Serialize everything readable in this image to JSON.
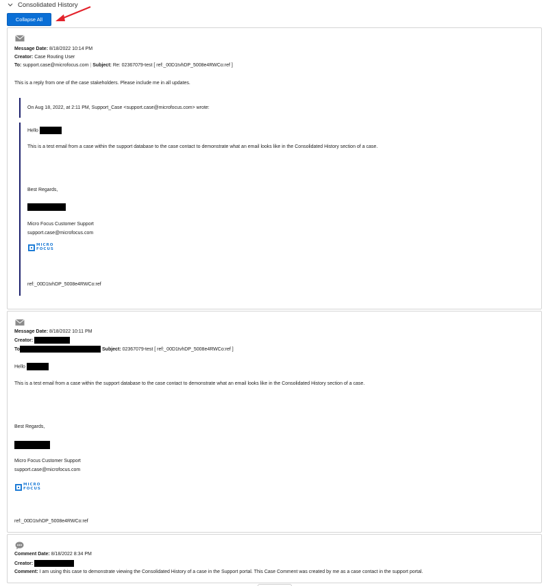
{
  "section": {
    "title": "Consolidated History"
  },
  "toolbar": {
    "collapse_label": "Collapse All"
  },
  "labels": {
    "message_date": "Message Date:",
    "creator": "Creator:",
    "to": "To:",
    "to_redacted": "To",
    "subject": "Subject:",
    "comment_date": "Comment Date:",
    "comment": "Comment:"
  },
  "email1": {
    "date": "8/18/2022 10:14 PM",
    "creator": "Case Routing User",
    "to": "support.case@microfocus.com",
    "subject": "Re: 02367079-test [ ref:_00D1tvhDP_5008e4RWCo:ref ]",
    "body": "This is a reply from one of the case stakeholders. Please include me in all updates.",
    "quote_header": "On Aug 18, 2022, at 2:11 PM, Support_Case <support.case@microfocus.com> wrote:",
    "greeting": "Hello",
    "quoted_body": "This is a test email from a case within the support database to the case contact to demonstrate what an email looks like in the Consolidated History section of a case.",
    "sign_off": "Best Regards,",
    "org": "Micro Focus Customer Support",
    "email": "support.case@microfocus.com",
    "logo_top": "MICRO",
    "logo_bottom": "FOCUS",
    "ref": "ref:_00D1tvhDP_5008e4RWCo:ref"
  },
  "email2": {
    "date": "8/18/2022 10:11 PM",
    "subject": "02367079-test [ ref:_00D1tvhDP_5008e4RWCo:ref ]",
    "greeting": "Hello",
    "body": "This is a test email from a case within the support database to the case contact to demonstrate what an email looks like in the Consolidated History section of a case.",
    "sign_off": "Best Regards,",
    "org": "Micro Focus Customer Support",
    "email": "support.case@microfocus.com",
    "logo_top": "MICRO",
    "logo_bottom": "FOCUS",
    "ref": "ref:_00D1tvhDP_5008e4RWCo:ref"
  },
  "comment1": {
    "date": "8/18/2022 8:34 PM",
    "text": "I am using this case to demonstrate viewing the Consolidated History of a case in the Support portal. This Case Comment was created by me as a case contact in the support portal."
  },
  "colors": {
    "accent": "#0a6fd6",
    "annotation_arrow": "#e3232c",
    "quote_bar": "#1b1f6b",
    "logo": "#1c7bd6"
  },
  "icons": {
    "section_toggle": "chevron-down-icon",
    "email": "envelope-icon",
    "comment": "speech-bubble-icon"
  }
}
